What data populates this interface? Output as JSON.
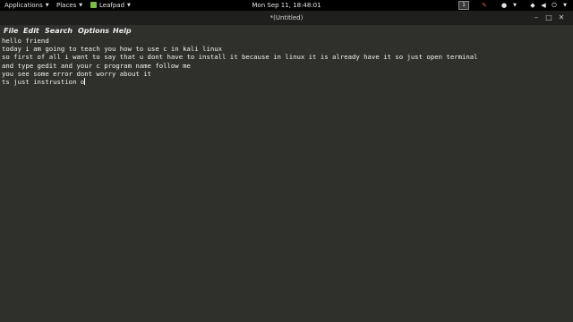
{
  "topbar": {
    "applications": "Applications",
    "places": "Places",
    "active_app": "Leafpad",
    "clock": "Mon Sep 11, 18:48:01",
    "workspace": "1",
    "tray_icons": [
      "keyboard-icon",
      "update-icon",
      "vpn-icon",
      "network-icon",
      "volume-icon",
      "power-icon"
    ]
  },
  "window": {
    "title": "*(Untitled)"
  },
  "menubar": {
    "file": "File",
    "edit": "Edit",
    "search": "Search",
    "options": "Options",
    "help": "Help"
  },
  "editor": {
    "lines": [
      "hello friend",
      "today i am going to teach you how to use c in kali linux",
      "so first of all i want to say that u dont have to install it because in linux it is already have it so just open terminal",
      "and type gedit and your c program name follow me",
      "you see some error dont worry about it",
      "ts just instrustion o"
    ]
  }
}
